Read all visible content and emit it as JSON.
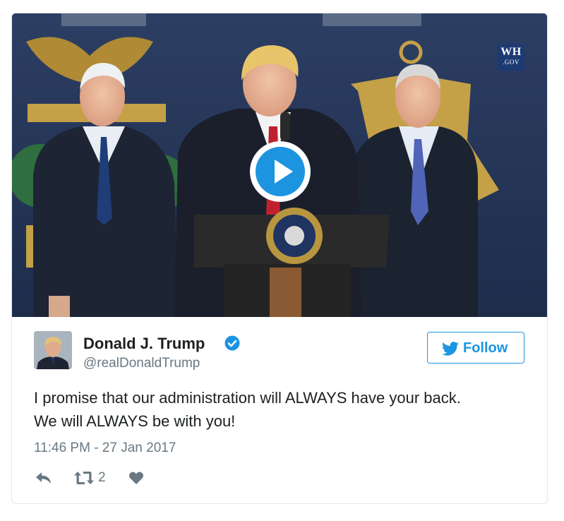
{
  "media": {
    "badge_line1": "WH",
    "badge_line2": ".GOV",
    "play_icon": "play-icon"
  },
  "user": {
    "name": "Donald J. Trump",
    "handle": "@realDonaldTrump",
    "verified_icon": "verified-badge-icon"
  },
  "follow": {
    "label": "Follow",
    "icon": "twitter-bird-icon",
    "color": "#1b95e0"
  },
  "tweet": {
    "line1": "I promise that our administration will ALWAYS have your back.",
    "line2": "We will ALWAYS be with you!",
    "timestamp": "11:46 PM - 27 Jan 2017"
  },
  "actions": {
    "reply_icon": "reply-icon",
    "retweet_icon": "retweet-icon",
    "retweet_count": "2",
    "like_icon": "heart-icon"
  },
  "colors": {
    "accent": "#1b95e0",
    "secondary_text": "#697882",
    "primary_text": "#1c2022"
  }
}
